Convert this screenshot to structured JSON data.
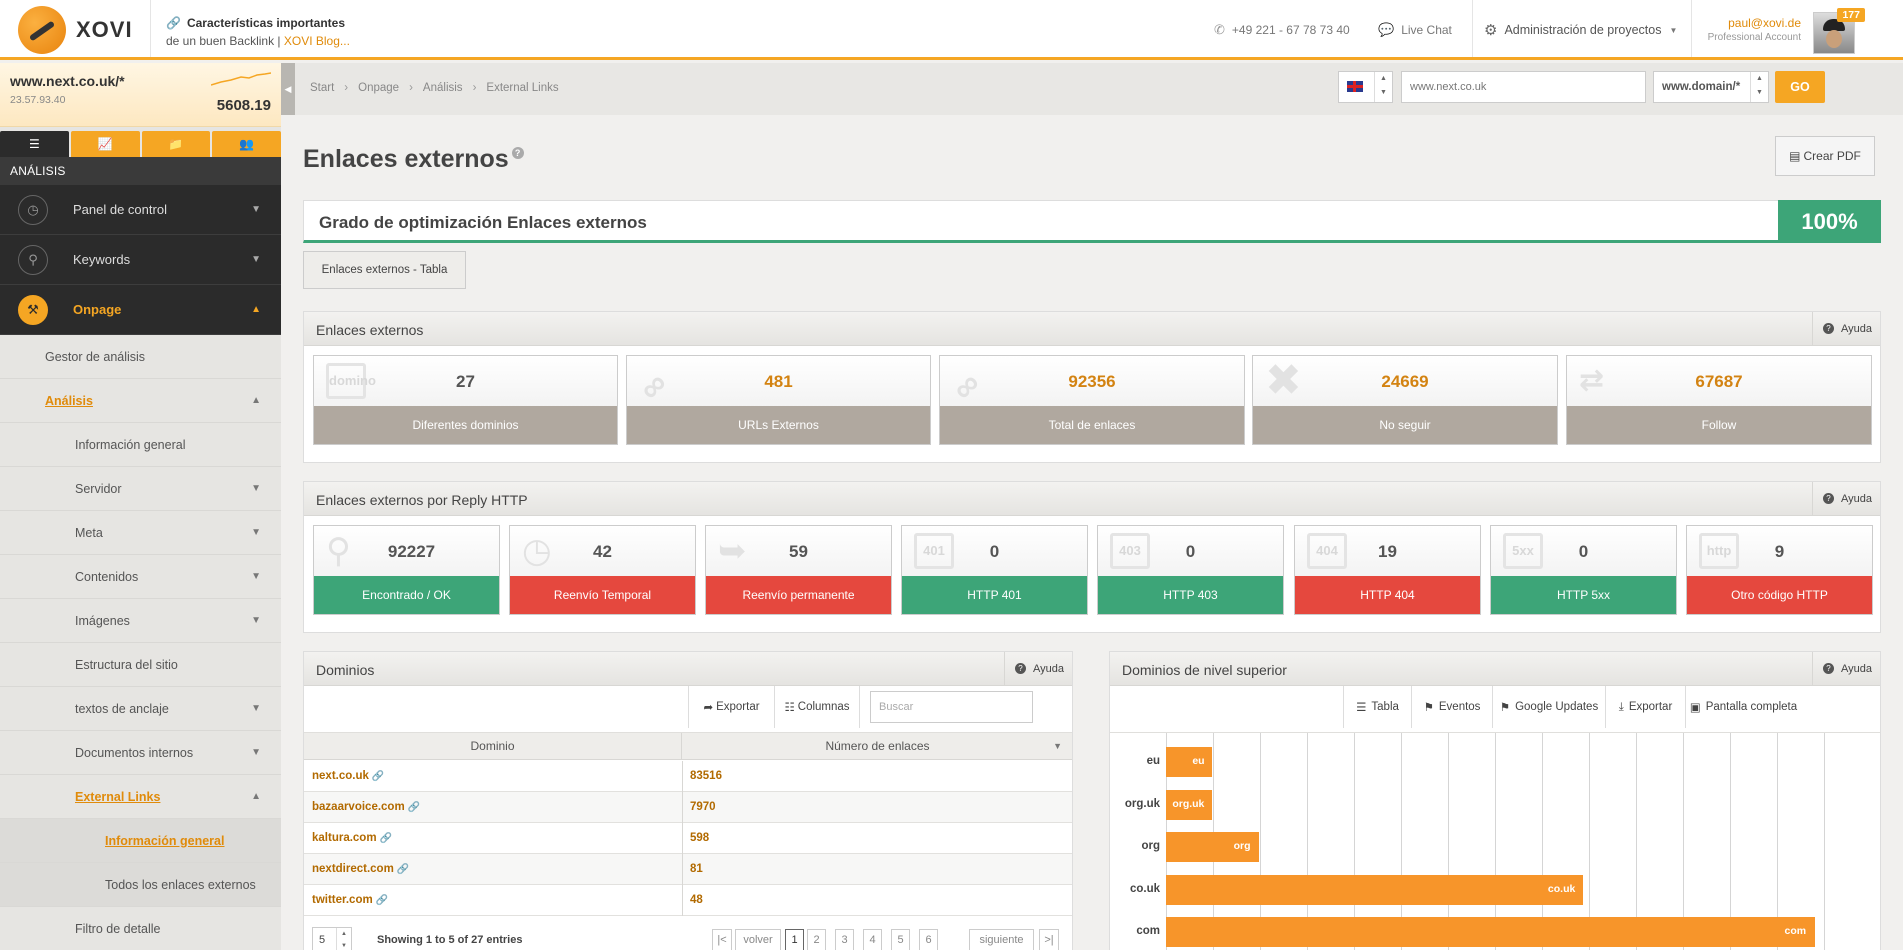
{
  "topbar": {
    "logo_text": "XOVI",
    "promo_icon": "link-icon",
    "promo_line1": "Características importantes",
    "promo_line2": "de un buen Backlink | ",
    "promo_link": "XOVI Blog...",
    "phone": "+49 221 - 67 78 73 40",
    "live_chat": "Live Chat",
    "admin": "Administración de proyectos",
    "user_email": "paul@xovi.de",
    "account_type": "Professional Account",
    "badge": "177"
  },
  "sidebar": {
    "domain": "www.next.co.uk/*",
    "ip": "23.57.93.40",
    "score": "5608.19",
    "section": "ANÁLISIS",
    "main_items": [
      {
        "label": "Panel de control",
        "icon": "dashboard-icon"
      },
      {
        "label": "Keywords",
        "icon": "key-icon"
      },
      {
        "label": "Onpage",
        "icon": "wrench-icon"
      }
    ],
    "sub_items": [
      "Gestor de análisis",
      "Análisis",
      "Información general",
      "Servidor",
      "Meta",
      "Contenidos",
      "Imágenes",
      "Estructura del sitio",
      "textos de anclaje",
      "Documentos internos",
      "External Links",
      "Información general",
      "Todos los enlaces externos",
      "Filtro de detalle"
    ]
  },
  "breadcrumb": [
    "Start",
    "Onpage",
    "Análisis",
    "External Links"
  ],
  "search": {
    "url_value": "www.next.co.uk",
    "domain_mode": "www.domain/*",
    "go_label": "GO"
  },
  "page": {
    "title": "Enlaces externos",
    "pdf_label": "Crear PDF",
    "optimization_label": "Grado de optimización Enlaces externos",
    "optimization_value": "100%",
    "table_tab": "Enlaces externos - Tabla"
  },
  "help_label": "Ayuda",
  "external_links": {
    "title": "Enlaces externos",
    "cards": [
      {
        "value": "27",
        "label": "Diferentes dominios",
        "icon": "domain-icon",
        "icon_text": "domino"
      },
      {
        "value": "481",
        "label": "URLs Externos",
        "icon": "chain-link-icon"
      },
      {
        "value": "92356",
        "label": "Total de enlaces",
        "icon": "chain-link-icon"
      },
      {
        "value": "24669",
        "label": "No seguir",
        "icon": "cross-icon"
      },
      {
        "value": "67687",
        "label": "Follow",
        "icon": "arrows-icon"
      }
    ]
  },
  "http_reply": {
    "title": "Enlaces externos por Reply HTTP",
    "cards": [
      {
        "value": "92227",
        "label": "Encontrado / OK",
        "status": "green",
        "icon": "magnifier-icon"
      },
      {
        "value": "42",
        "label": "Reenvío Temporal",
        "status": "red",
        "icon": "clock-inbox-icon"
      },
      {
        "value": "59",
        "label": "Reenvío permanente",
        "status": "red",
        "icon": "inbox-arrow-icon"
      },
      {
        "value": "0",
        "label": "HTTP 401",
        "status": "green",
        "icon": "http-401-icon",
        "icon_text": "401"
      },
      {
        "value": "0",
        "label": "HTTP 403",
        "status": "green",
        "icon": "http-403-icon",
        "icon_text": "403"
      },
      {
        "value": "19",
        "label": "HTTP 404",
        "status": "red",
        "icon": "http-404-icon",
        "icon_text": "404"
      },
      {
        "value": "0",
        "label": "HTTP 5xx",
        "status": "green",
        "icon": "http-5xx-icon",
        "icon_text": "5xx"
      },
      {
        "value": "9",
        "label": "Otro código HTTP",
        "status": "red",
        "icon": "http-other-icon",
        "icon_text": "http"
      }
    ]
  },
  "domains": {
    "title": "Dominios",
    "export": "Exportar",
    "columns": "Columnas",
    "search_placeholder": "Buscar",
    "col_domain": "Dominio",
    "col_links": "Número de enlaces",
    "rows": [
      {
        "domain": "next.co.uk",
        "links": "83516"
      },
      {
        "domain": "bazaarvoice.com",
        "links": "7970"
      },
      {
        "domain": "kaltura.com",
        "links": "598"
      },
      {
        "domain": "nextdirect.com",
        "links": "81"
      },
      {
        "domain": "twitter.com",
        "links": "48"
      }
    ],
    "page_length": "5",
    "showing": "Showing 1 to 5 of 27 entries",
    "pager": {
      "first": "|<",
      "prev": "volver",
      "pages": [
        "1",
        "2",
        "3",
        "4",
        "5",
        "6"
      ],
      "next": "siguiente",
      "last": ">|",
      "current": "1"
    }
  },
  "tld": {
    "title": "Dominios de nivel superior",
    "toolbar": [
      {
        "label": "Tabla",
        "icon": "table-icon"
      },
      {
        "label": "Eventos",
        "icon": "flag-icon"
      },
      {
        "label": "Google Updates",
        "icon": "flag-icon"
      },
      {
        "label": "Exportar",
        "icon": "download-icon"
      },
      {
        "label": "Pantalla completa",
        "icon": "fullscreen-icon"
      }
    ]
  },
  "chart_data": {
    "type": "bar",
    "orientation": "horizontal",
    "categories": [
      "eu",
      "org.uk",
      "org",
      "co.uk",
      "com"
    ],
    "values": [
      45,
      45,
      90,
      405,
      630
    ],
    "xlim": [
      0,
      680
    ],
    "grid": true,
    "legend": "none"
  },
  "colors": {
    "accent": "#f5a623",
    "green": "#3da578",
    "red": "#e5483e",
    "neutral": "#b0a89f",
    "bar": "#f7952a"
  }
}
